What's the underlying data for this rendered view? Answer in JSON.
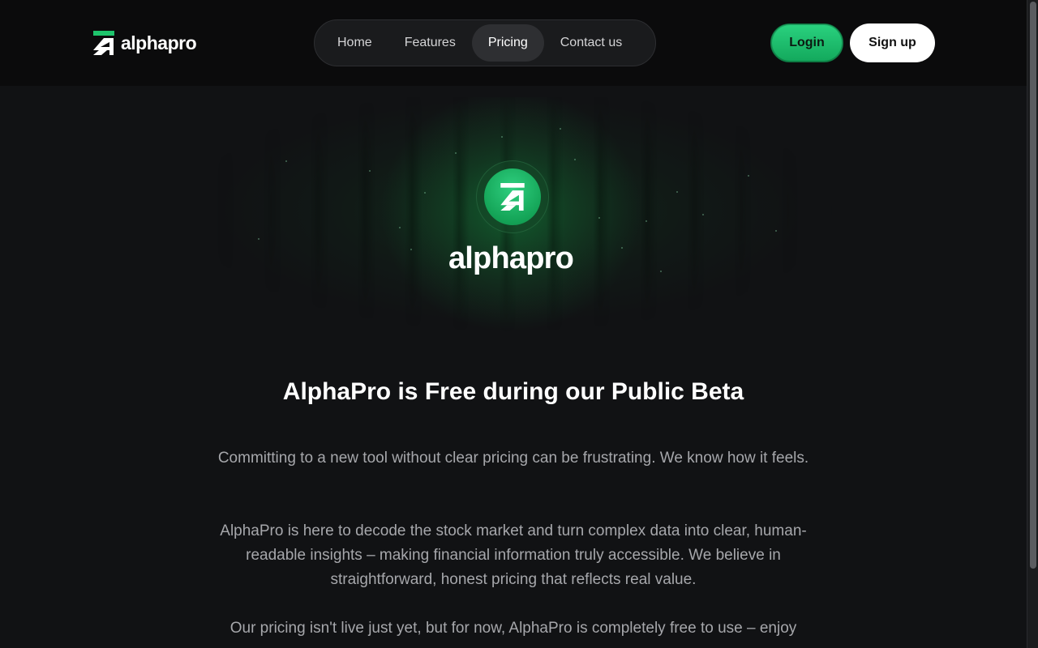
{
  "brand": {
    "name": "alphapro",
    "accent_color": "#1ec46c"
  },
  "nav": {
    "items": [
      {
        "label": "Home",
        "active": false
      },
      {
        "label": "Features",
        "active": false
      },
      {
        "label": "Pricing",
        "active": true
      },
      {
        "label": "Contact us",
        "active": false
      }
    ]
  },
  "auth": {
    "login_label": "Login",
    "signup_label": "Sign up"
  },
  "hero": {
    "name": "alphapro",
    "icon": "alphapro-logo-icon"
  },
  "content": {
    "headline": "AlphaPro is Free during our Public Beta",
    "paragraphs": [
      "Committing to a new tool without clear pricing can be frustrating. We know how it feels.",
      "AlphaPro is here to decode the stock market and turn complex data into clear, human-readable insights – making financial information truly accessible. We believe in straightforward, honest pricing that reflects real value.",
      "Our pricing isn't live just yet, but for now, AlphaPro is completely free to use – enjoy"
    ]
  },
  "colors": {
    "background": "#111214",
    "header_background": "#0b0b0c",
    "login_button": "#1ec46c",
    "body_text": "#a6a7ab"
  }
}
